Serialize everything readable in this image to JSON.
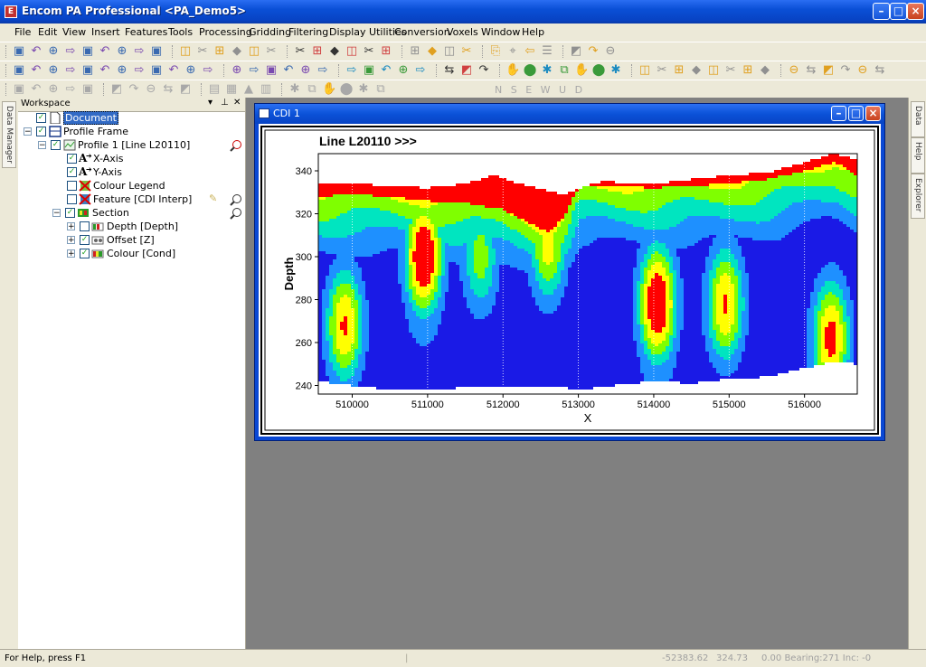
{
  "app": {
    "title": "Encom PA Professional <PA_Demo5>",
    "icon_letter": "E"
  },
  "menu": [
    "File",
    "Edit",
    "View",
    "Insert",
    "Features",
    "Tools",
    "Processing",
    "Gridding",
    "Filtering",
    "Display Utilities",
    "Conversion",
    "Voxels",
    "Window",
    "Help"
  ],
  "toolbar3_text": "N  S  E  W  U  D",
  "side_tabs": {
    "left": "Data Manager",
    "right": [
      "Data",
      "Help",
      "Explorer"
    ]
  },
  "workspace": {
    "title": "Workspace",
    "tree": [
      {
        "label": "Document",
        "selected": true
      },
      {
        "label": "Profile Frame"
      },
      {
        "label": "Profile 1 [Line L20110]"
      },
      {
        "label": "X-Axis"
      },
      {
        "label": "Y-Axis"
      },
      {
        "label": "Colour Legend"
      },
      {
        "label": "Feature [CDI Interp]"
      },
      {
        "label": "Section"
      },
      {
        "label": "Depth [Depth]"
      },
      {
        "label": "Offset [Z]"
      },
      {
        "label": "Colour [Cond]"
      }
    ]
  },
  "child_window": {
    "title": "CDI 1"
  },
  "chart_data": {
    "type": "heatmap",
    "title": "Line L20110 >>>",
    "xlabel": "X",
    "ylabel": "Depth",
    "x_ticks": [
      510000,
      511000,
      512000,
      513000,
      514000,
      515000,
      516000
    ],
    "y_ticks": [
      240,
      260,
      280,
      300,
      320,
      340
    ],
    "xlim": [
      509550,
      516700
    ],
    "ylim": [
      236,
      348
    ],
    "grid": "vertical dotted",
    "colors": {
      "low": "#1a1ae6",
      "mid_low": "#1e90ff",
      "mid": "#00e5c0",
      "mid_high": "#7fff00",
      "high": "#ffff00",
      "top": "#ff0000"
    },
    "surface_top": [
      [
        509550,
        334
      ],
      [
        510000,
        334
      ],
      [
        510500,
        333
      ],
      [
        511000,
        332
      ],
      [
        511500,
        334
      ],
      [
        511900,
        338
      ],
      [
        512200,
        334
      ],
      [
        512800,
        329
      ],
      [
        513300,
        335
      ],
      [
        514000,
        334
      ],
      [
        514500,
        336
      ],
      [
        515000,
        338
      ],
      [
        515500,
        339
      ],
      [
        516000,
        344
      ],
      [
        516400,
        348
      ],
      [
        516700,
        345
      ]
    ],
    "red_bottom": [
      [
        509550,
        328
      ],
      [
        510000,
        329
      ],
      [
        510500,
        328
      ],
      [
        511000,
        326
      ],
      [
        511500,
        325
      ],
      [
        512000,
        322
      ],
      [
        512400,
        315
      ],
      [
        512600,
        311
      ],
      [
        512800,
        318
      ],
      [
        513000,
        332
      ],
      [
        513300,
        333
      ],
      [
        514000,
        332
      ],
      [
        514500,
        333
      ],
      [
        515000,
        334
      ],
      [
        515500,
        336
      ],
      [
        516000,
        340
      ],
      [
        516400,
        344
      ],
      [
        516700,
        338
      ]
    ],
    "ground_bottom": [
      [
        509550,
        242
      ],
      [
        510000,
        240
      ],
      [
        510500,
        238
      ],
      [
        511000,
        238
      ],
      [
        511500,
        239
      ],
      [
        512000,
        239
      ],
      [
        512600,
        240
      ],
      [
        513000,
        238
      ],
      [
        513500,
        240
      ],
      [
        514000,
        242
      ],
      [
        514500,
        241
      ],
      [
        515000,
        243
      ],
      [
        515500,
        244
      ],
      [
        516000,
        248
      ],
      [
        516400,
        251
      ],
      [
        516700,
        250
      ]
    ],
    "anomalies": [
      {
        "x": 509900,
        "depth": 268,
        "strength": 0.8
      },
      {
        "x": 510950,
        "depth": 300,
        "strength": 1.0
      },
      {
        "x": 511700,
        "depth": 300,
        "strength": 0.55
      },
      {
        "x": 512600,
        "depth": 306,
        "strength": 0.7
      },
      {
        "x": 514050,
        "depth": 278,
        "strength": 1.0
      },
      {
        "x": 514950,
        "depth": 278,
        "strength": 0.8
      },
      {
        "x": 516350,
        "depth": 262,
        "strength": 0.85
      }
    ]
  },
  "status": {
    "help": "For Help, press F1",
    "x": "-52383.62",
    "y": "324.73",
    "info": "0.00  Bearing:271  Inc: -0"
  }
}
